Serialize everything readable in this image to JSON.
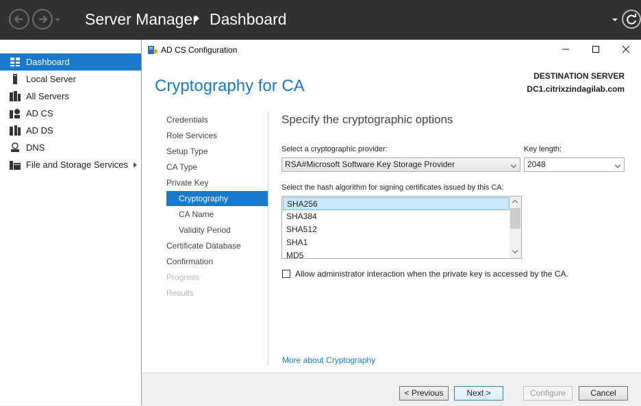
{
  "header": {
    "app_title": "Server Manager",
    "page_title": "Dashboard"
  },
  "sidebar": {
    "items": [
      {
        "label": "Dashboard",
        "icon": "dashboard-icon",
        "active": true
      },
      {
        "label": "Local Server",
        "icon": "server-icon"
      },
      {
        "label": "All Servers",
        "icon": "servers-icon"
      },
      {
        "label": "AD CS",
        "icon": "adcs-icon"
      },
      {
        "label": "AD DS",
        "icon": "adds-icon"
      },
      {
        "label": "DNS",
        "icon": "dns-icon"
      },
      {
        "label": "File and Storage Services",
        "icon": "storage-icon",
        "has_submenu": true
      }
    ]
  },
  "dialog": {
    "window_title": "AD CS Configuration",
    "heading": "Cryptography for CA",
    "destination_label": "DESTINATION SERVER",
    "destination_server": "DC1.citrixzindagilab.com",
    "wizard_steps": [
      {
        "label": "Credentials",
        "state": "normal"
      },
      {
        "label": "Role Services",
        "state": "normal"
      },
      {
        "label": "Setup Type",
        "state": "normal"
      },
      {
        "label": "CA Type",
        "state": "normal"
      },
      {
        "label": "Private Key",
        "state": "normal"
      },
      {
        "label": "Cryptography",
        "state": "active",
        "sub": true
      },
      {
        "label": "CA Name",
        "state": "normal",
        "sub": true
      },
      {
        "label": "Validity Period",
        "state": "normal",
        "sub": true
      },
      {
        "label": "Certificate Database",
        "state": "normal"
      },
      {
        "label": "Confirmation",
        "state": "normal"
      },
      {
        "label": "Progress",
        "state": "disabled"
      },
      {
        "label": "Results",
        "state": "disabled"
      }
    ],
    "content": {
      "title": "Specify the cryptographic options",
      "provider_label": "Select a cryptographic provider:",
      "provider_value": "RSA#Microsoft Software Key Storage Provider",
      "key_length_label": "Key length:",
      "key_length_value": "2048",
      "hash_label": "Select the hash algorithm for signing certificates issued by this CA:",
      "hash_options": [
        "SHA256",
        "SHA384",
        "SHA512",
        "SHA1",
        "MD5"
      ],
      "hash_selected": "SHA256",
      "admin_interaction_label": "Allow administrator interaction when the private key is accessed by the CA.",
      "admin_interaction_checked": false,
      "more_link": "More about Cryptography"
    },
    "buttons": {
      "previous": "< Previous",
      "next": "Next >",
      "configure": "Configure",
      "cancel": "Cancel"
    }
  },
  "colors": {
    "accent": "#1979ca",
    "titlebar": "#313131"
  }
}
